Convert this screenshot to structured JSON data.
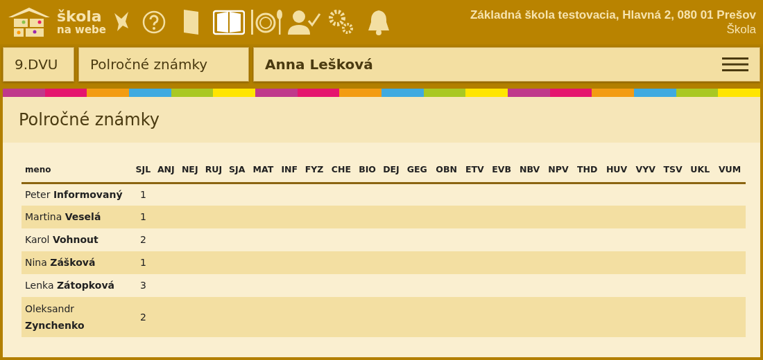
{
  "header": {
    "logo_line1": "škola",
    "logo_line2": "na webe",
    "school": "Základná škola testovacia, Hlavná 2, 080 01 Prešov",
    "role": "Škola"
  },
  "nav": {
    "class": "9.DVU",
    "section": "Polročné známky",
    "student": "Anna Lešková"
  },
  "page_title": "Polročné známky",
  "table": {
    "columns": [
      "meno",
      "SJL",
      "ANJ",
      "NEJ",
      "RUJ",
      "SJA",
      "MAT",
      "INF",
      "FYZ",
      "CHE",
      "BIO",
      "DEJ",
      "GEG",
      "OBN",
      "ETV",
      "EVB",
      "NBV",
      "NPV",
      "THD",
      "HUV",
      "VYV",
      "TSV",
      "UKL",
      "VUM"
    ],
    "rows": [
      {
        "name": "Peter **Informovaný**",
        "grades": [
          "1"
        ]
      },
      {
        "name": "Martina **Veselá**",
        "grades": [
          "1"
        ]
      },
      {
        "name": "Karol **Vohnout**",
        "grades": [
          "2"
        ]
      },
      {
        "name": "Nina **Zášková**",
        "grades": [
          "1"
        ]
      },
      {
        "name": "Lenka **Zátopková**",
        "grades": [
          "3"
        ]
      },
      {
        "name": "Oleksandr **Zynchenko**",
        "grades": [
          "2"
        ]
      }
    ]
  }
}
